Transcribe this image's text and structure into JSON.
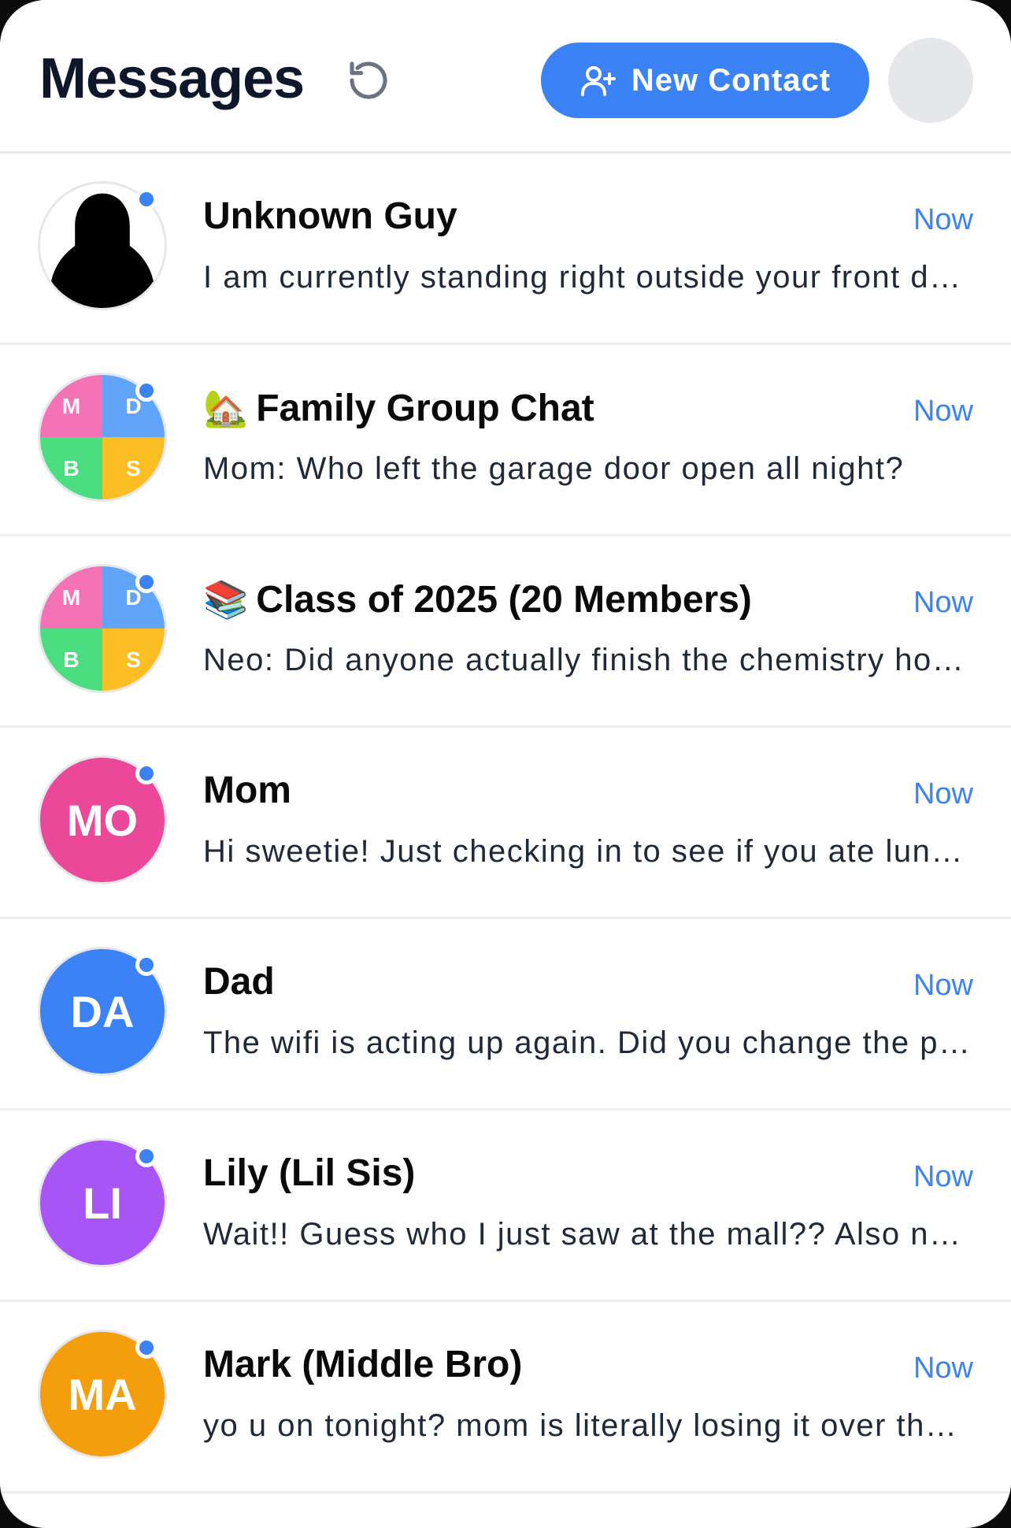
{
  "header": {
    "title": "Messages",
    "new_contact_label": "New Contact",
    "refresh_icon": "refresh-icon",
    "add_user_icon": "user-plus-icon"
  },
  "colors": {
    "accent": "#3b82f6",
    "mom": "#ec4899",
    "dad": "#3b82f6",
    "lily": "#a855f7",
    "mark": "#f59e0b"
  },
  "conversations": [
    {
      "name": "Unknown Guy",
      "emoji": "",
      "time": "Now",
      "preview": "I am currently standing right outside your front door",
      "avatar_type": "silhouette"
    },
    {
      "name": "Family Group Chat",
      "emoji": "🏡",
      "time": "Now",
      "preview": "Mom: Who left the garage door open all night?",
      "avatar_type": "group",
      "quads": [
        "M",
        "D",
        "B",
        "S"
      ]
    },
    {
      "name": "Class of 2025 (20 Members)",
      "emoji": "📚",
      "time": "Now",
      "preview": "Neo: Did anyone actually finish the chemistry homework?",
      "avatar_type": "group",
      "quads": [
        "M",
        "D",
        "B",
        "S"
      ]
    },
    {
      "name": "Mom",
      "emoji": "",
      "time": "Now",
      "preview": "Hi sweetie! Just checking in to see if you ate lunch today",
      "avatar_type": "initials",
      "initials": "MO"
    },
    {
      "name": "Dad",
      "emoji": "",
      "time": "Now",
      "preview": "The wifi is acting up again. Did you change the password?",
      "avatar_type": "initials",
      "initials": "DA"
    },
    {
      "name": "Lily (Lil Sis)",
      "emoji": "",
      "time": "Now",
      "preview": "Wait!! Guess who I just saw at the mall?? Also need a ride",
      "avatar_type": "initials",
      "initials": "LI"
    },
    {
      "name": "Mark (Middle Bro)",
      "emoji": "",
      "time": "Now",
      "preview": "yo u on tonight? mom is literally losing it over the dishes",
      "avatar_type": "initials",
      "initials": "MA"
    }
  ]
}
